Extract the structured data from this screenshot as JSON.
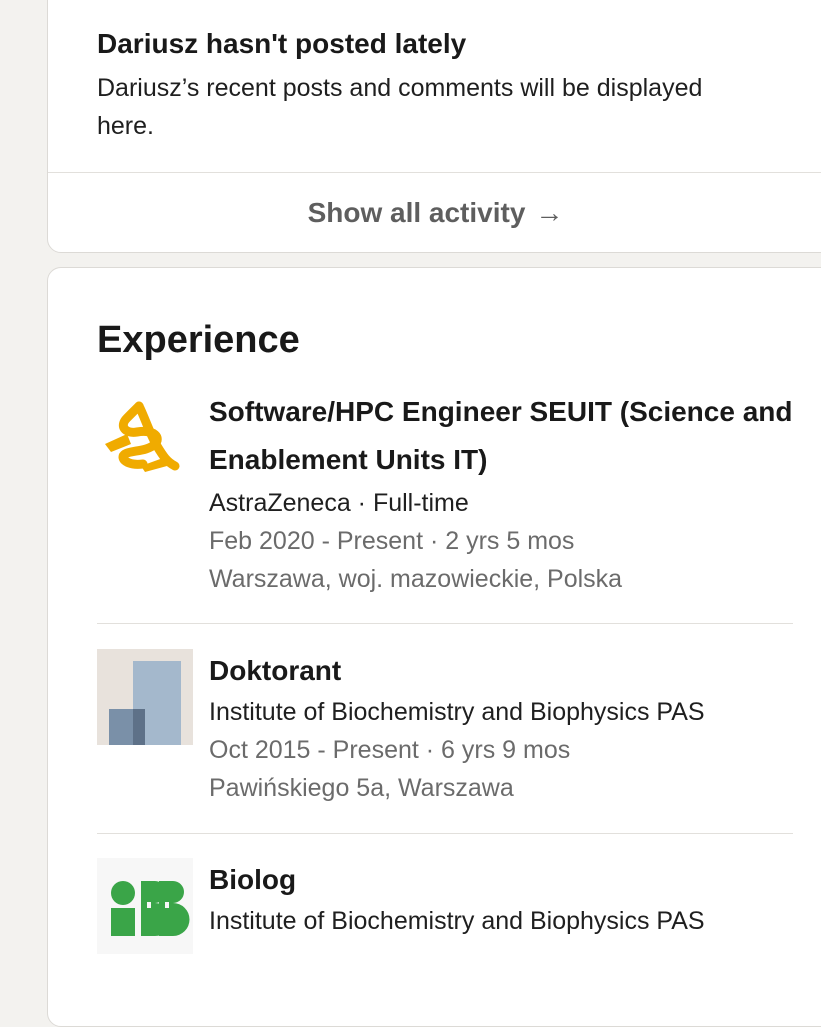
{
  "activity": {
    "title": "Dariusz hasn't posted lately",
    "description": "Dariusz’s recent posts and comments will be displayed here.",
    "show_all_label": "Show all activity",
    "show_all_arrow": "→"
  },
  "experience": {
    "title": "Experience",
    "items": [
      {
        "logo": "astrazeneca-logo",
        "title": "Software/HPC Engineer SEUIT (Science and Enablement Units IT)",
        "company": "AstraZeneca · Full-time",
        "dates": "Feb 2020 - Present · 2 yrs 5 mos",
        "location": "Warszawa, woj. mazowieckie, Polska"
      },
      {
        "logo": "placeholder-company-logo",
        "title": "Doktorant",
        "company": "Institute of Biochemistry and Biophysics PAS",
        "dates": "Oct 2015 - Present · 6 yrs 9 mos",
        "location": "Pawińskiego 5a, Warszawa"
      },
      {
        "logo": "ibb-logo",
        "title": "Biolog",
        "company": "Institute of Biochemistry and Biophysics PAS"
      }
    ]
  },
  "colors": {
    "page_bg": "#f3f2ef",
    "card_bg": "#ffffff",
    "text_primary": "#191919",
    "text_muted": "#6b6b6b",
    "astrazeneca_gold": "#f0ab00",
    "ibb_green": "#3aa548"
  }
}
